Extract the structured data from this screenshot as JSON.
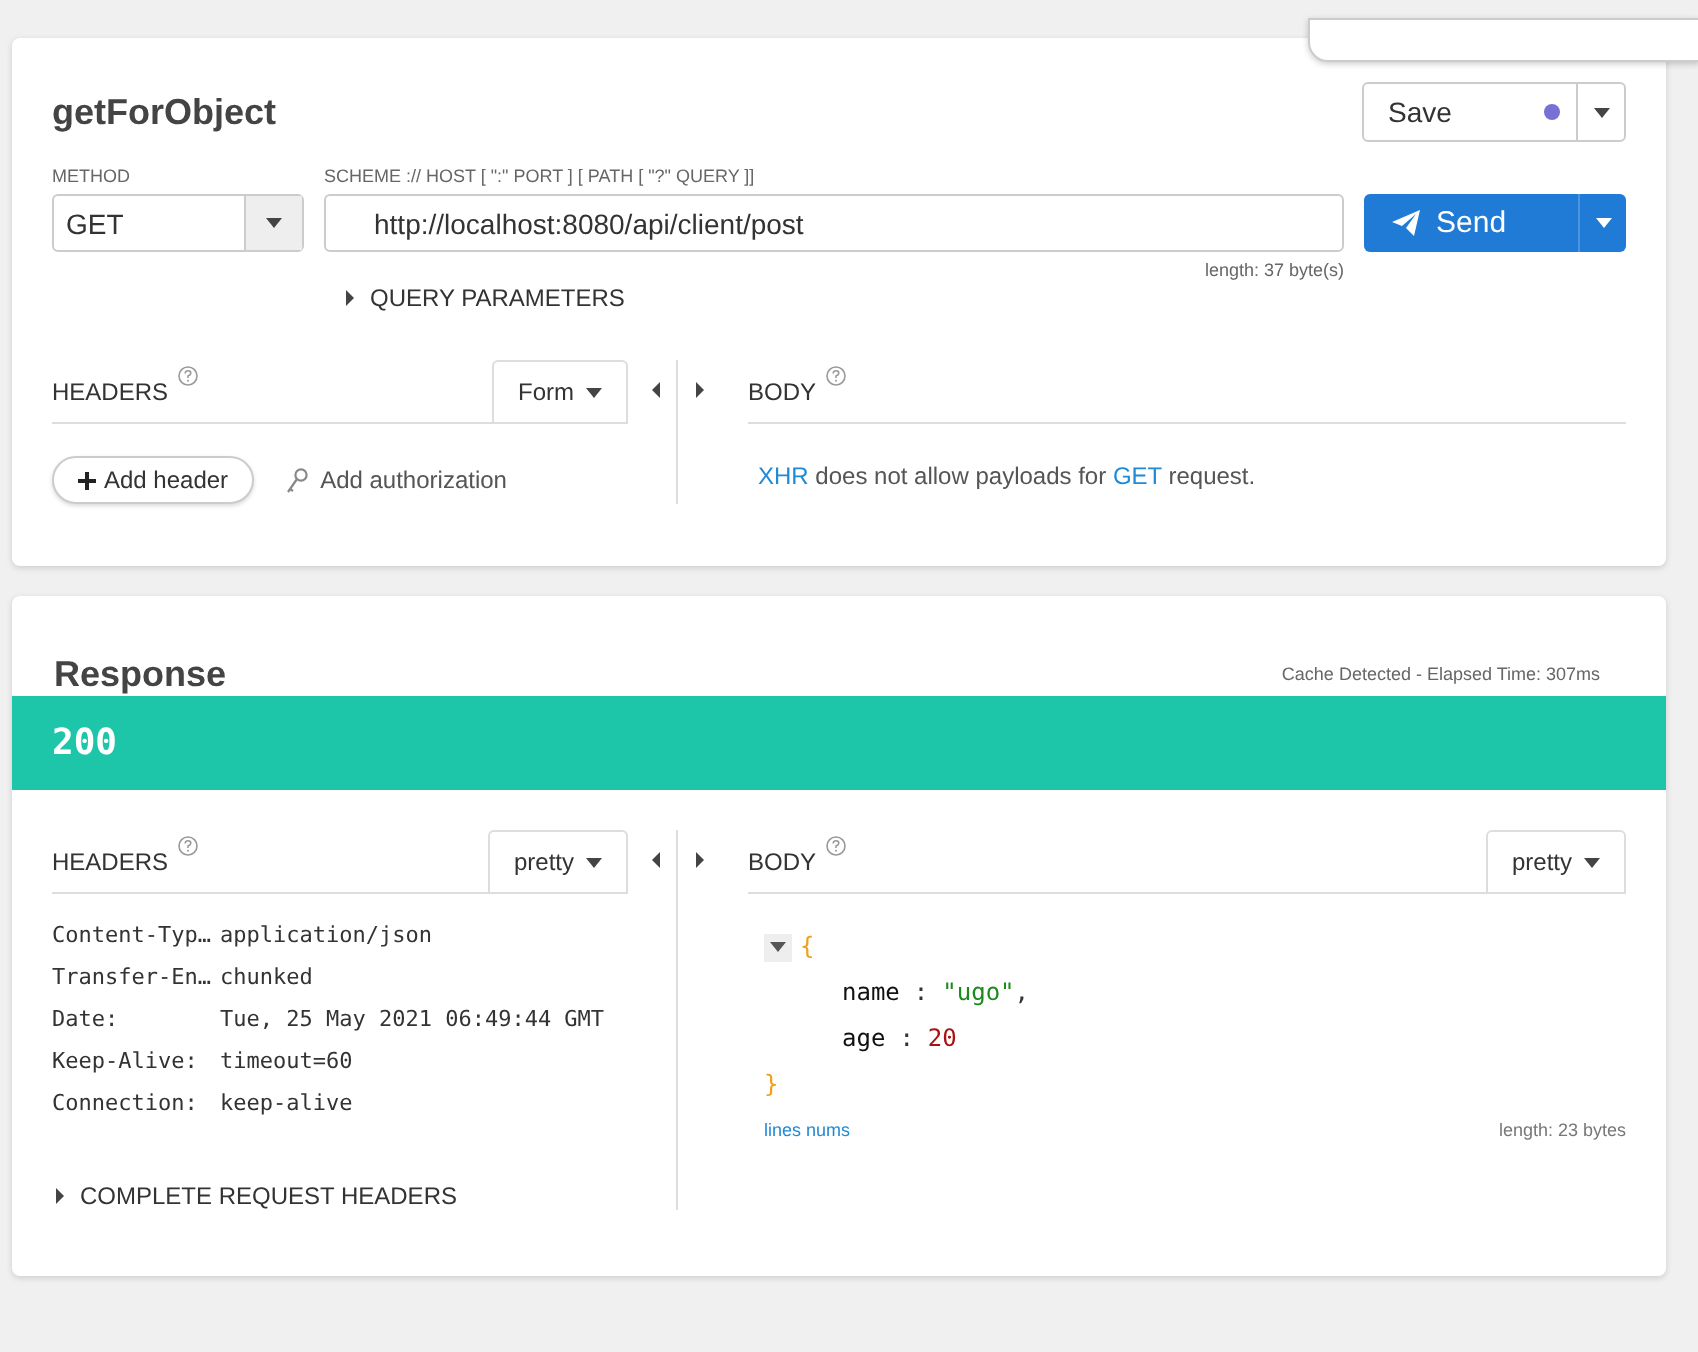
{
  "request": {
    "title": "getForObject",
    "save": {
      "label": "Save",
      "unsaved": true
    },
    "method": {
      "label": "METHOD",
      "value": "GET"
    },
    "url": {
      "label": "SCHEME :// HOST [ \":\" PORT ] [ PATH [ \"?\" QUERY ]]",
      "value": "http://localhost:8080/api/client/post",
      "length": "length: 37 byte(s)"
    },
    "send": "Send",
    "query_parameters": {
      "label": "QUERY PARAMETERS",
      "expanded": false
    },
    "headers": {
      "label": "HEADERS",
      "mode": "Form",
      "add_header": "Add header",
      "add_authorization": "Add authorization"
    },
    "body": {
      "label": "BODY",
      "message": [
        {
          "text": "XHR",
          "kind": "link"
        },
        {
          "text": " does not allow payloads for ",
          "kind": "plain"
        },
        {
          "text": "GET",
          "kind": "link"
        },
        {
          "text": " request.",
          "kind": "plain"
        }
      ]
    }
  },
  "response": {
    "title": "Response",
    "timing": "Cache Detected - Elapsed Time: 307ms",
    "status": {
      "code": "200",
      "kind": "success"
    },
    "headers": {
      "label": "HEADERS",
      "mode": "pretty",
      "rows": [
        {
          "name": "Content-Typ…",
          "value": "application/json"
        },
        {
          "name": "Transfer-En…",
          "value": "chunked"
        },
        {
          "name": "Date:",
          "value": "Tue, 25 May 2021 06:49:44 GMT"
        },
        {
          "name": "Keep-Alive:",
          "value": "timeout=60"
        },
        {
          "name": "Connection:",
          "value": "keep-alive"
        }
      ],
      "complete_request_headers": {
        "label": "COMPLETE REQUEST HEADERS",
        "expanded": false
      }
    },
    "body": {
      "label": "BODY",
      "mode": "pretty",
      "expanded": true,
      "open": "{",
      "close": "}",
      "fields": [
        {
          "key": "name",
          "colon": ":",
          "value": "\"ugo\"",
          "kind": "string",
          "trailing": ","
        },
        {
          "key": "age",
          "colon": ":",
          "value": "20",
          "kind": "number"
        }
      ],
      "lines_nums": "lines nums",
      "length": "length: 23 bytes"
    }
  }
}
